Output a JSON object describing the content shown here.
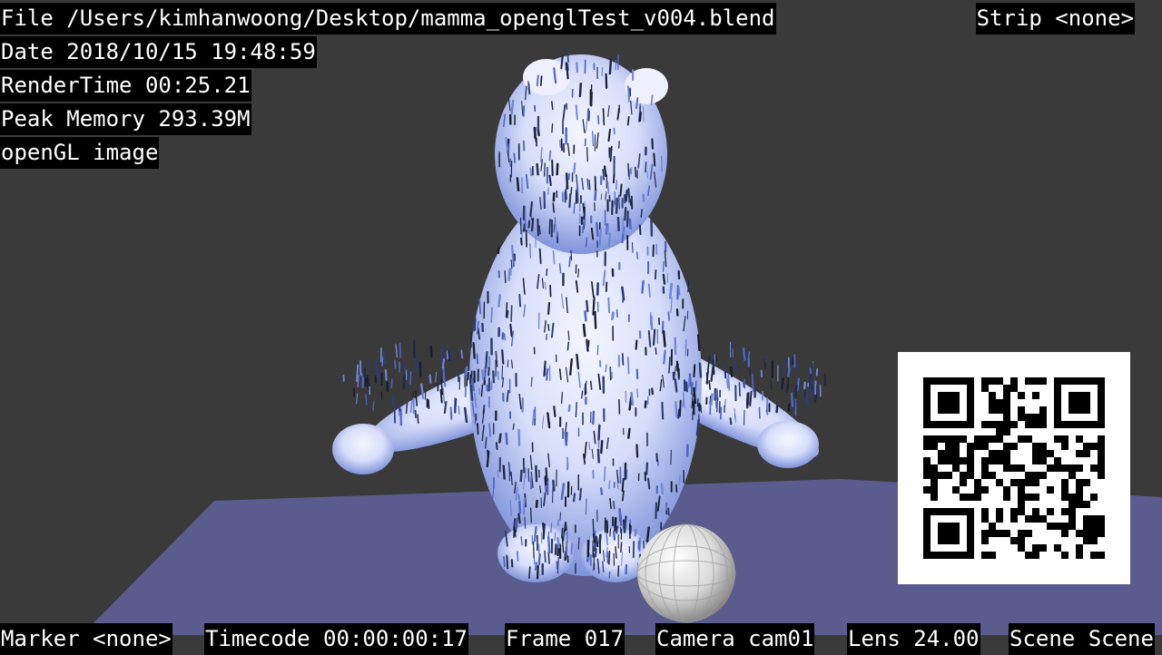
{
  "metadata_stamp": {
    "file": "File /Users/kimhanwoong/Desktop/mamma_openglTest_v004.blend",
    "date": "Date 2018/10/15 19:48:59",
    "render_time": "RenderTime 00:25.21",
    "peak_memory": "Peak Memory 293.39M",
    "note": "openGL image",
    "strip": "Strip <none>",
    "marker": "Marker <none>",
    "timecode": "Timecode 00:00:00:17",
    "frame": "Frame 017",
    "camera": "Camera cam01",
    "lens": "Lens 24.00",
    "scene": "Scene Scene"
  },
  "colors": {
    "background": "#3a3a3a",
    "ground_plane": "#595c8c",
    "fur_light": "#e8ecff",
    "fur_blue": "#6f86d8",
    "fur_dark": "#1f2a48",
    "stamp_bg": "#000000",
    "stamp_text": "#ffffff"
  }
}
